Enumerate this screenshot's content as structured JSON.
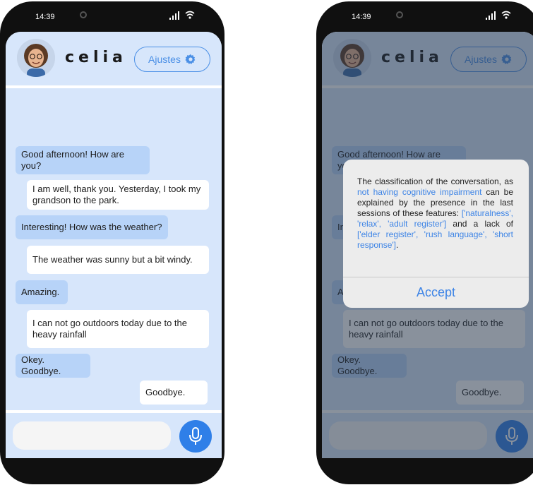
{
  "status_bar": {
    "time": "14:39"
  },
  "header": {
    "app_name": "celia",
    "settings_label": "Ajustes"
  },
  "messages": [
    {
      "sender": "bot",
      "text": "Good afternoon! How are you?"
    },
    {
      "sender": "user",
      "text": "I am well, thank you. Yesterday, I took my grandson to the park."
    },
    {
      "sender": "bot",
      "text": "Interesting! How was the weather?"
    },
    {
      "sender": "user",
      "text": "The weather was sunny but a bit windy."
    },
    {
      "sender": "bot",
      "text": "Amazing."
    },
    {
      "sender": "user",
      "text": "I can not go outdoors today due to the heavy rainfall"
    },
    {
      "sender": "bot",
      "text": "Okey. Goodbye."
    },
    {
      "sender": "user",
      "text": "Goodbye."
    }
  ],
  "dialog": {
    "text_1": "The classification of the conversation, as",
    "highlight_1": "not having cognitive impairment",
    "text_2": "can be explained by the presence in the last sessions of these features:",
    "highlight_2": "['naturalness', 'relax', 'adult register']",
    "text_3": "and a lack of",
    "highlight_3": "['elder register', 'rush language', 'short response']",
    "text_4": ".",
    "accept_label": "Accept"
  },
  "colors": {
    "accent": "#2f7fe8",
    "bot_bubble": "#b7d3f8",
    "user_bubble": "#ffffff",
    "background": "#d7e6fb"
  },
  "icons": [
    "avatar",
    "gear-icon",
    "microphone-icon",
    "signal-icon",
    "wifi-icon"
  ]
}
